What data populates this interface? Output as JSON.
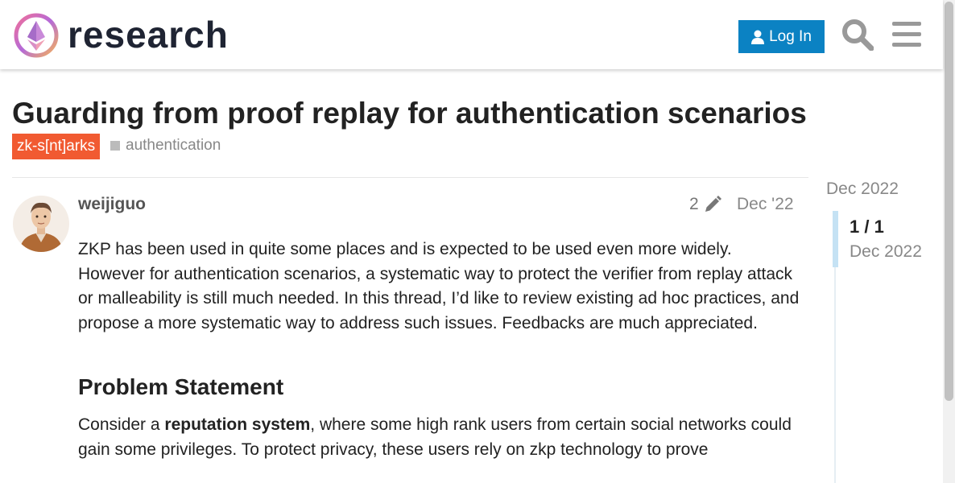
{
  "header": {
    "brand": "research",
    "login_label": "Log In",
    "icons": {
      "logo": "ethereum-research-logo",
      "login": "user-icon",
      "search": "search-icon",
      "menu": "hamburger-menu-icon"
    },
    "colors": {
      "login_bg": "#0b82c3"
    }
  },
  "topic": {
    "title": "Guarding from proof replay for authentication scenarios",
    "category": "zk-s[nt]arks",
    "category_color": "#f15a31",
    "tag": "authentication"
  },
  "post": {
    "username": "weijiguo",
    "edit_count": "2",
    "date": "Dec '22",
    "paragraph1": "ZKP has been used in quite some places and is expected to be used even more widely. However for authentication scenarios, a systematic way to protect the verifier from replay attack or malleability is still much needed. In this thread, I’d like to review existing ad hoc practices, and propose a more systematic way to address such issues. Feedbacks are much appreciated.",
    "heading": "Problem Statement",
    "paragraph2_pre": "Consider a ",
    "paragraph2_bold": "reputation system",
    "paragraph2_post": ", where some high rank users from certain social networks could gain some privileges. To protect privacy, these users rely on zkp technology to prove"
  },
  "timeline": {
    "top_date": "Dec 2022",
    "count": "1 / 1",
    "bottom_date": "Dec 2022"
  }
}
